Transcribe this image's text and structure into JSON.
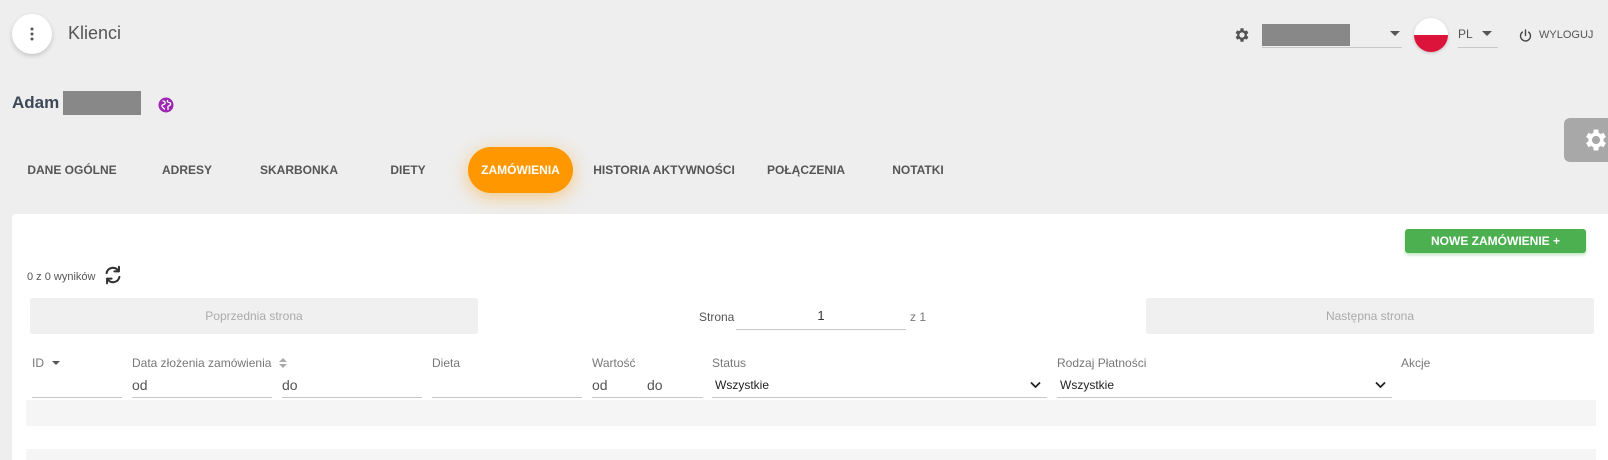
{
  "header": {
    "title": "Klienci",
    "language": "PL",
    "logout_label": "WYLOGUJ"
  },
  "client": {
    "first_name": "Adam"
  },
  "tabs": [
    {
      "label": "DANE OGÓLNE",
      "active": false
    },
    {
      "label": "ADRESY",
      "active": false
    },
    {
      "label": "SKARBONKA",
      "active": false
    },
    {
      "label": "DIETY",
      "active": false
    },
    {
      "label": "ZAMÓWIENIA",
      "active": true
    },
    {
      "label": "HISTORIA AKTYWNOŚCI",
      "active": false
    },
    {
      "label": "POŁĄCZENIA",
      "active": false
    },
    {
      "label": "NOTATKI",
      "active": false
    }
  ],
  "orders": {
    "new_order_label": "NOWE ZAMÓWIENIE +",
    "results_text": "0 z 0 wyników",
    "prev_page_label": "Poprzednia strona",
    "next_page_label": "Następna strona",
    "page_label": "Strona",
    "page_value": "1",
    "page_total": "z 1"
  },
  "columns": {
    "id": "ID",
    "date": "Data złożenia zamówienia",
    "diet": "Dieta",
    "value": "Wartość",
    "status": "Status",
    "payment": "Rodzaj Płatności",
    "actions": "Akcje"
  },
  "filters": {
    "date_from_placeholder": "od",
    "date_to_placeholder": "do",
    "value_from_placeholder": "od",
    "value_to_placeholder": "do",
    "status_selected": "Wszystkie",
    "payment_selected": "Wszystkie"
  },
  "colors": {
    "accent": "#ff9800",
    "success": "#4caf50",
    "globe": "#9c27b0",
    "flag_red": "#dc143c"
  }
}
